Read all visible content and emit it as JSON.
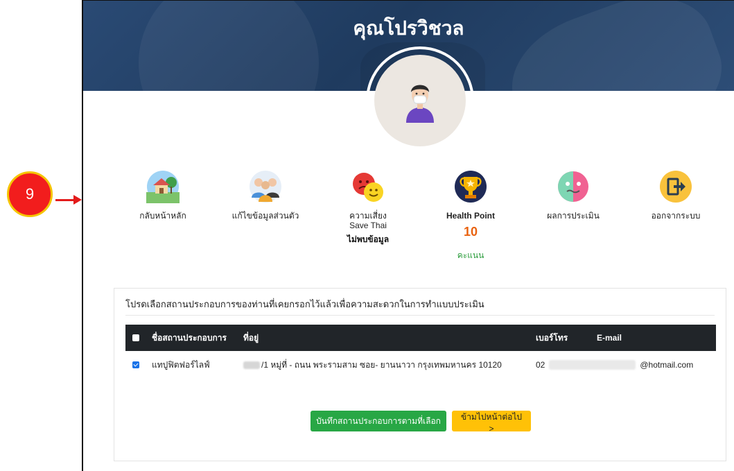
{
  "annotation": {
    "step_number": "9"
  },
  "header": {
    "title": "คุณโปรวิชวล"
  },
  "menu": {
    "items": [
      {
        "label": "กลับหน้าหลัก",
        "icon": "home-icon"
      },
      {
        "label": "แก้ไขข้อมูลส่วนตัว",
        "icon": "people-icon"
      },
      {
        "label": "ความเสี่ยง",
        "sub": "Save Thai",
        "status": "ไม่พบข้อมูล",
        "icon": "faces-icon"
      },
      {
        "label": "Health Point",
        "value": "10",
        "unit": "คะแนน",
        "icon": "trophy-icon"
      },
      {
        "label": "ผลการประเมิน",
        "icon": "assessment-face-icon"
      },
      {
        "label": "ออกจากระบบ",
        "icon": "logout-icon"
      }
    ]
  },
  "panel": {
    "heading": "โปรดเลือกสถานประกอบการของท่านที่เคยกรอกไว้แล้วเพื่อความสะดวกในการทำแบบประเมิน",
    "columns": {
      "name": "ชื่อสถานประกอบการ",
      "address": "ที่อยู่",
      "phone": "เบอร์โทร",
      "email": "E-mail"
    },
    "rows": [
      {
        "checked": true,
        "name": "แทปูฟิตฟอร์ไลฟ์",
        "address": "/1 หมู่ที่ - ถนน พระรามสาม ซอย- ยานนาวา กรุงเทพมหานคร 10120",
        "phone": "02",
        "email": "@hotmail.com"
      }
    ],
    "save_button": "บันทึกสถานประกอบการตามที่เลือก",
    "skip_button": "ข้ามไปหน้าต่อไป >"
  },
  "colors": {
    "banner": "#2a4a74",
    "save": "#28a745",
    "skip": "#ffc107",
    "health_value": "#e9620f",
    "health_unit": "#2e9e3f"
  }
}
